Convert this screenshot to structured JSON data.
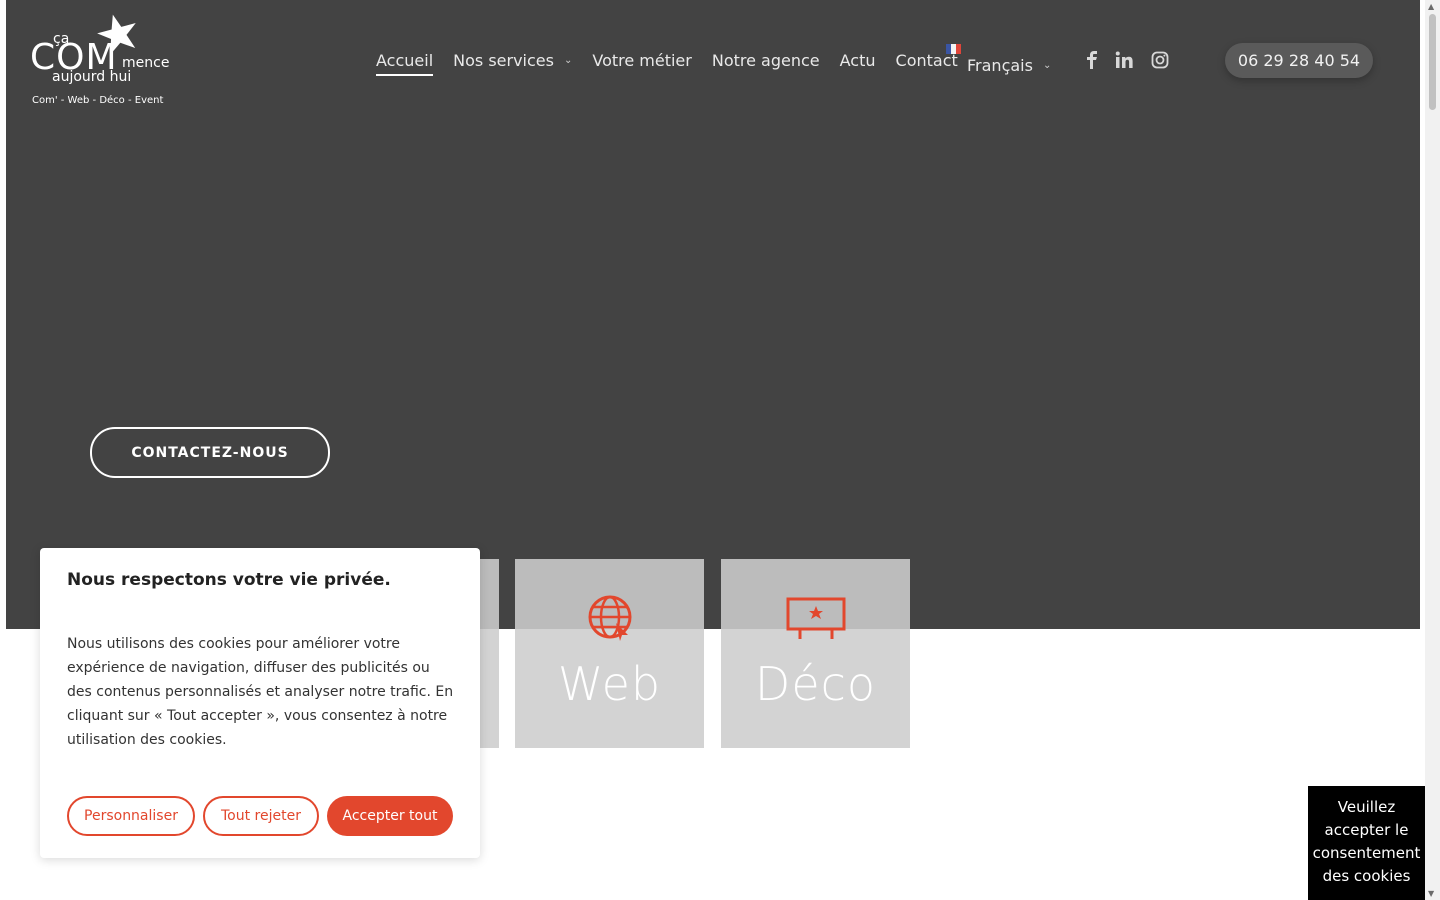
{
  "logo": {
    "ca": "ça",
    "com": "COM",
    "mence": "mence",
    "aujourd": "aujourd hui",
    "tagline": "Com' - Web - Déco - Event"
  },
  "nav": {
    "items": [
      {
        "label": "Accueil",
        "active": true
      },
      {
        "label": "Nos services",
        "has_dropdown": true
      },
      {
        "label": "Votre métier"
      },
      {
        "label": "Notre agence"
      },
      {
        "label": "Actu"
      },
      {
        "label": "Contact"
      }
    ],
    "language": "Français"
  },
  "social": {
    "facebook": "facebook-icon",
    "linkedin": "linkedin-icon",
    "instagram": "instagram-icon"
  },
  "phone": "06 29 28 40 54",
  "hero": {
    "cta_label": "CONTACTEZ-NOUS"
  },
  "tiles": [
    {
      "label": "Web",
      "icon": "globe-icon"
    },
    {
      "label": "Déco",
      "icon": "billboard-icon"
    }
  ],
  "cookie": {
    "title": "Nous respectons votre vie privée.",
    "text": "Nous utilisons des cookies pour améliorer votre expérience de navigation, diffuser des publicités ou des contenus personnalisés et analyser notre trafic. En cliquant sur « Tout accepter », vous consentez à notre utilisation des cookies.",
    "customize": "Personnaliser",
    "reject": "Tout rejeter",
    "accept": "Accepter tout"
  },
  "consent_notice": "Veuillez accepter le consentement des cookies",
  "colors": {
    "hero_bg": "#434343",
    "accent": "#e2472d"
  }
}
